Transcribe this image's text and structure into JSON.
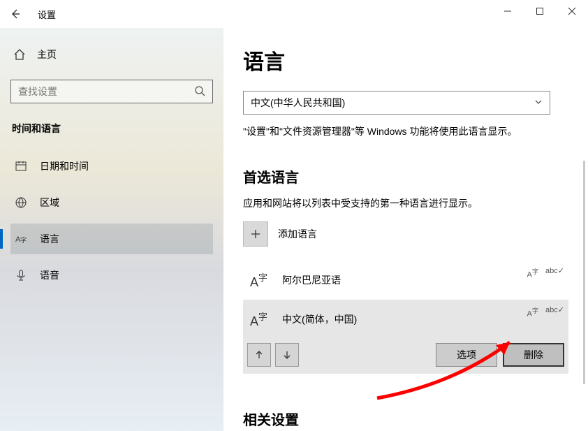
{
  "titlebar": {
    "app_title": "设置"
  },
  "sidebar": {
    "home_label": "主页",
    "search_placeholder": "查找设置",
    "section_title": "时间和语言",
    "items": [
      {
        "label": "日期和时间"
      },
      {
        "label": "区域"
      },
      {
        "label": "语言"
      },
      {
        "label": "语音"
      }
    ]
  },
  "content": {
    "page_title": "语言",
    "display_language_value": "中文(中华人民共和国)",
    "display_language_desc": "\"设置\"和\"文件资源管理器\"等 Windows 功能将使用此语言显示。",
    "preferred_title": "首选语言",
    "preferred_desc": "应用和网站将以列表中受支持的第一种语言进行显示。",
    "add_language_label": "添加语言",
    "languages": [
      {
        "name": "阿尔巴尼亚语"
      },
      {
        "name": "中文(简体，中国)"
      }
    ],
    "options_button": "选项",
    "delete_button": "删除",
    "related_title": "相关设置"
  }
}
